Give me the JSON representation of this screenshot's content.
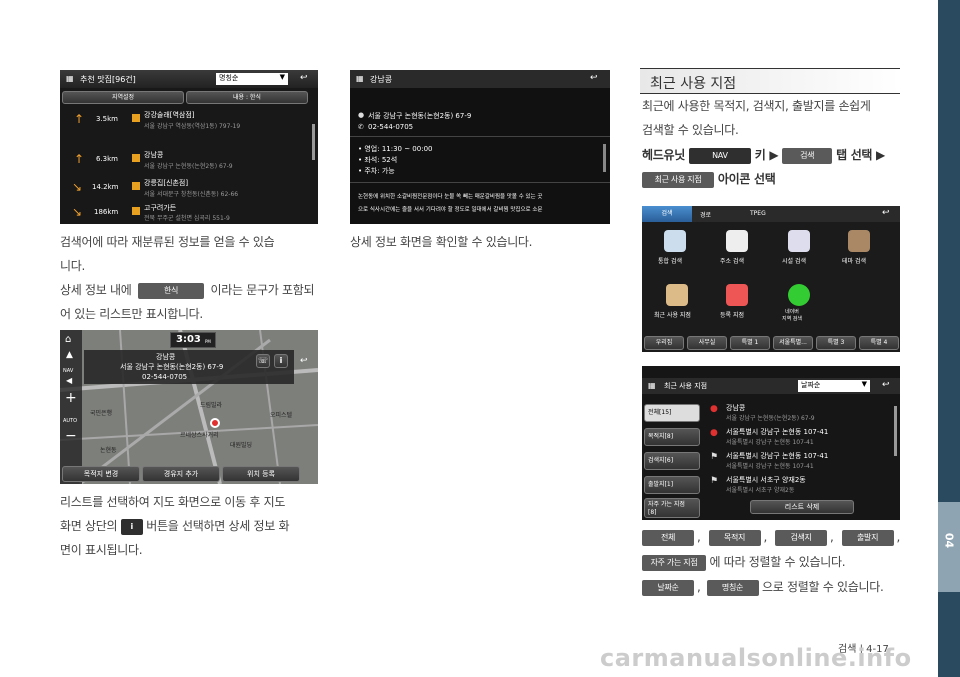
{
  "side_tab": {
    "chapter": "04",
    "bg": "#2a4a5f",
    "active": "#8fa4b2"
  },
  "page_number": "검색 | 4-17",
  "watermark": "carmanualsonline.info",
  "s1": {
    "title": "추천 맛집[96건]",
    "sort": "명칭순",
    "tab1": "지역설정",
    "tab2": "내용 : 한식",
    "rows": [
      {
        "dist": "3.5km",
        "name": "강강술래[역삼점]",
        "addr": "서울 강남구 역삼동(역삼1동) 797-19"
      },
      {
        "dist": "6.3km",
        "name": "강남콩",
        "addr": "서울 강남구 논현동(논현2동) 67-9"
      },
      {
        "dist": "14.2km",
        "name": "강릉집[신촌점]",
        "addr": "서울 서대문구 창천동(신촌동) 62-66"
      },
      {
        "dist": "186km",
        "name": "고구려가든",
        "addr": "전북 무주군 설천면 심곡리 551-9"
      }
    ]
  },
  "p1": {
    "l1": "검색어에 따라 재분류된 정보를 얻을 수 있습",
    "l2": "니다.",
    "l3a": "상세 정보 내에",
    "chip": "한식",
    "l3b": "이라는 문구가 포함되",
    "l4": "어 있는 리스트만 표시합니다."
  },
  "s2": {
    "title": "강남콩",
    "addr": "서울 강남구 논현동(논현2동) 67-9",
    "phone": "02-544-0705",
    "info": [
      "• 영업: 11:30 ~ 00:00",
      "• 좌석: 52석",
      "• 주차: 가능"
    ],
    "desc": [
      "논현동에 위치한 소갈비찜전문점이다 눈물 쏙 빼는 매운갈비찜을 맛볼 수 있는 곳",
      "으로 식사시간에는 줄을 서서 기다려야 할 정도로 일대에서 갈비찜 맛집으로 소문"
    ]
  },
  "p2": {
    "l1": "상세 정보 화면을 확인할 수 있습니다."
  },
  "s3": {
    "time": "3:03",
    "pm": "PM",
    "name": "강남콩",
    "addr": "서울 강남구 논현동(논현2동) 67-9",
    "phone": "02-544-0705",
    "nav": "NAV",
    "auto": "AUTO",
    "btns": [
      "목적지 변경",
      "경유지 추가",
      "위치 등록"
    ],
    "labels": [
      "드림빌라",
      "국민은행",
      "르네상스사거리",
      "대원빌딩",
      "논현동",
      "오피스텔"
    ]
  },
  "p3": {
    "l1": "리스트를 선택하여 지도 화면으로 이동 후 지도",
    "l2a": "화면 상단의",
    "l2b": "버튼을 선택하면 상세 정보 화",
    "l3": "면이 표시됩니다."
  },
  "heading": "최근 사용 지점",
  "r1": {
    "l1": "최근에 사용한 목적지, 검색지, 출발지를 손쉽게",
    "l2": "검색할 수 있습니다."
  },
  "r2": {
    "a": "헤드유닛",
    "nav": "NAV",
    "b": "키 ▶",
    "search": "검색",
    "c": "탭 선택 ▶",
    "chip": "최근 사용 지점",
    "d": "아이콘 선택"
  },
  "s4": {
    "tabs": [
      "검색",
      "경로",
      "TPEG"
    ],
    "icons": [
      "통합 검색",
      "주소 검색",
      "시설 검색",
      "테마 검색",
      "최근 사용 지점",
      "등록 지점",
      "네이버\n지역 검색"
    ],
    "bottom": [
      "우리집",
      "사무실",
      "특별 1",
      "서울특별...",
      "특별 3",
      "특별 4"
    ]
  },
  "s5": {
    "title": "최근 사용 지점",
    "sort": "날짜순",
    "side": [
      "전체[15]",
      "목적지[8]",
      "검색지[6]",
      "출발지[1]",
      "자주 가는 지점\n[8]"
    ],
    "rows": [
      {
        "name": "강남콩",
        "addr": "서울 강남구 논현동(논현2동) 67-9"
      },
      {
        "name": "서울특별시 강남구 논현동 107-41",
        "addr": "서울특별시 강남구 논현동 107-41"
      },
      {
        "name": "서울특별시 강남구 논현동 107-41",
        "addr": "서울특별시 강남구 논현동 107-41"
      },
      {
        "name": "서울특별시 서초구 양재2동",
        "addr": "서울특별시 서초구 양재2동"
      }
    ],
    "delete": "리스트 삭제"
  },
  "legend": {
    "chips": [
      "전체",
      "목적지",
      "검색지",
      "출발지"
    ],
    "sep": ",",
    "chip5": "자주 가는 지점",
    "t1": "에 따라 정렬할 수 있습니다.",
    "chip6": "날짜순",
    "chip7": "명칭순",
    "t2": "으로 정렬할 수 있습니다."
  }
}
